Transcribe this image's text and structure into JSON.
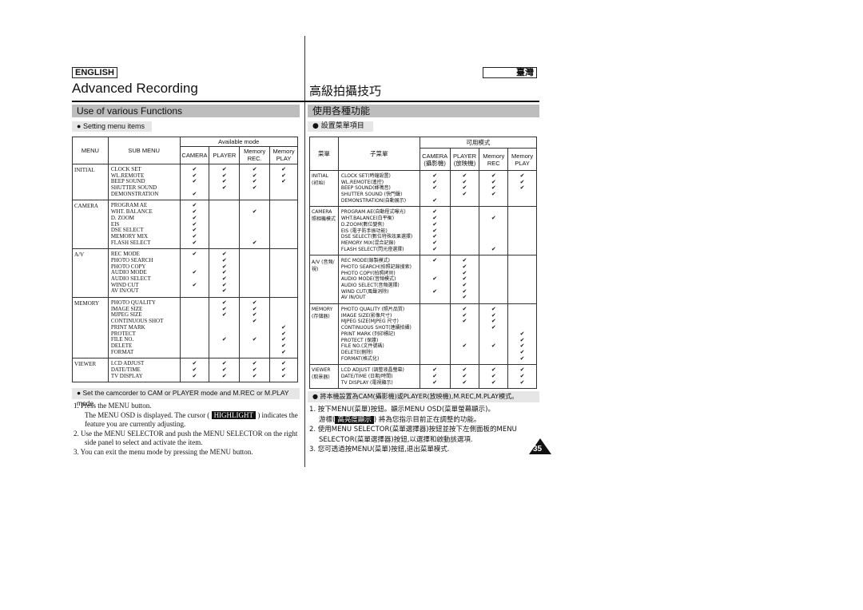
{
  "header": {
    "lang_en": "ENGLISH",
    "lang_zh": "臺灣",
    "title_en": "Advanced Recording",
    "title_zh": "高級拍攝技巧",
    "section_en": "Use of various Functions",
    "section_zh": "使用各種功能",
    "bullet_en": "Setting menu items",
    "bullet_zh": "設置菜單項目"
  },
  "table_en": {
    "menu": "MENU",
    "sub": "SUB MENU",
    "avail": "Available mode",
    "modes": [
      "CAMERA",
      "PLAYER",
      "Memory REC.",
      "Memory PLAY"
    ],
    "groups": [
      {
        "menu": "INITIAL",
        "items": [
          [
            "CLOCK SET",
            [
              1,
              1,
              1,
              1
            ]
          ],
          [
            "WL.REMOTE",
            [
              1,
              1,
              1,
              1
            ]
          ],
          [
            "BEEP SOUND",
            [
              1,
              1,
              1,
              1
            ]
          ],
          [
            "SHUTTER SOUND",
            [
              0,
              1,
              1,
              0
            ]
          ],
          [
            "DEMONSTRATION",
            [
              1,
              0,
              0,
              0
            ]
          ]
        ]
      },
      {
        "menu": "CAMERA",
        "items": [
          [
            "PROGRAM AE",
            [
              1,
              0,
              0,
              0
            ]
          ],
          [
            "WHT. BALANCE",
            [
              1,
              0,
              1,
              0
            ]
          ],
          [
            "D. ZOOM",
            [
              1,
              0,
              0,
              0
            ]
          ],
          [
            "EIS",
            [
              1,
              0,
              0,
              0
            ]
          ],
          [
            "DSE SELECT",
            [
              1,
              0,
              0,
              0
            ]
          ],
          [
            "MEMORY MIX",
            [
              1,
              0,
              0,
              0
            ]
          ],
          [
            "FLASH SELECT",
            [
              1,
              0,
              1,
              0
            ]
          ]
        ]
      },
      {
        "menu": "A/V",
        "items": [
          [
            "REC MODE",
            [
              1,
              1,
              0,
              0
            ]
          ],
          [
            "PHOTO SEARCH",
            [
              0,
              1,
              0,
              0
            ]
          ],
          [
            "PHOTO COPY",
            [
              0,
              1,
              0,
              0
            ]
          ],
          [
            "AUDIO MODE",
            [
              1,
              1,
              0,
              0
            ]
          ],
          [
            "AUDIO SELECT",
            [
              0,
              1,
              0,
              0
            ]
          ],
          [
            "WIND CUT",
            [
              1,
              1,
              0,
              0
            ]
          ],
          [
            "AV IN/OUT",
            [
              0,
              1,
              0,
              0
            ]
          ]
        ]
      },
      {
        "menu": "MEMORY",
        "items": [
          [
            "PHOTO QUALITY",
            [
              0,
              1,
              1,
              0
            ]
          ],
          [
            "IMAGE SIZE",
            [
              0,
              1,
              1,
              0
            ]
          ],
          [
            "MJPEG SIZE",
            [
              0,
              1,
              1,
              0
            ]
          ],
          [
            "CONTINUOUS SHOT",
            [
              0,
              0,
              1,
              0
            ]
          ],
          [
            "PRINT MARK",
            [
              0,
              0,
              0,
              1
            ]
          ],
          [
            "PROTECT",
            [
              0,
              0,
              0,
              1
            ]
          ],
          [
            "FILE NO.",
            [
              0,
              1,
              1,
              1
            ]
          ],
          [
            "DELETE",
            [
              0,
              0,
              0,
              1
            ]
          ],
          [
            "FORMAT",
            [
              0,
              0,
              0,
              1
            ]
          ]
        ]
      },
      {
        "menu": "VIEWER",
        "items": [
          [
            "LCD ADJUST",
            [
              1,
              1,
              1,
              1
            ]
          ],
          [
            "DATE/TIME",
            [
              1,
              1,
              1,
              1
            ]
          ],
          [
            "TV DISPLAY",
            [
              1,
              1,
              1,
              1
            ]
          ]
        ]
      }
    ]
  },
  "table_zh": {
    "menu": "菜單",
    "sub": "子菜單",
    "avail": "可用模式",
    "modes": [
      "CAMERA (攝影機)",
      "PLAYER (放映機)",
      "Memory REC",
      "Memory PLAY"
    ],
    "groups": [
      {
        "menu": "INITIAL (初始)",
        "items": [
          [
            "CLOCK SET(時鐘設置)",
            [
              1,
              1,
              1,
              1
            ]
          ],
          [
            "WL.REMOTE(遙控)",
            [
              1,
              1,
              1,
              1
            ]
          ],
          [
            "BEEP SOUND(蜂鳴音)",
            [
              1,
              1,
              1,
              1
            ]
          ],
          [
            "SHUTTER SOUND (快門聲)",
            [
              0,
              1,
              1,
              0
            ]
          ],
          [
            "DEMONSTRATION(自動展示)",
            [
              1,
              0,
              0,
              0
            ]
          ]
        ]
      },
      {
        "menu": "CAMERA 照相機模式",
        "items": [
          [
            "PROGRAM AE(自動程式曝光)",
            [
              1,
              0,
              0,
              0
            ]
          ],
          [
            "WHT.BALANCE(白平衡)",
            [
              1,
              0,
              1,
              0
            ]
          ],
          [
            "D.ZOOM(數位變焦)",
            [
              1,
              0,
              0,
              0
            ]
          ],
          [
            "EIS (電子防手振功能)",
            [
              1,
              0,
              0,
              0
            ]
          ],
          [
            "DSE SELECT(數位特殊效果選擇)",
            [
              1,
              0,
              0,
              0
            ]
          ],
          [
            "MEMORY MIX(混合記錄)",
            [
              1,
              0,
              0,
              0
            ]
          ],
          [
            "FLASH SELECT(閃光燈選擇)",
            [
              1,
              0,
              1,
              0
            ]
          ]
        ]
      },
      {
        "menu": "A/V (音頻/視)",
        "items": [
          [
            "REC MODE(錄製模式)",
            [
              1,
              1,
              0,
              0
            ]
          ],
          [
            "PHOTO SEARCH(拍照記錄搜索)",
            [
              0,
              1,
              0,
              0
            ]
          ],
          [
            "PHOTO COPY(拍照拷貝)",
            [
              0,
              1,
              0,
              0
            ]
          ],
          [
            "AUDIO MODE(音頻模式)",
            [
              1,
              1,
              0,
              0
            ]
          ],
          [
            "AUDIO SELECT(音頻選擇)",
            [
              0,
              1,
              0,
              0
            ]
          ],
          [
            "WIND CUT(風聲消除)",
            [
              1,
              1,
              0,
              0
            ]
          ],
          [
            "AV IN/OUT",
            [
              0,
              1,
              0,
              0
            ]
          ]
        ]
      },
      {
        "menu": "MEMORY (存儲器)",
        "items": [
          [
            "PHOTO QUALITY (照片品質)",
            [
              0,
              1,
              1,
              0
            ]
          ],
          [
            "IMAGE SIZE(影像尺寸)",
            [
              0,
              1,
              1,
              0
            ]
          ],
          [
            "MJPEG SIZE(MJPEG 尺寸)",
            [
              0,
              1,
              1,
              0
            ]
          ],
          [
            "CONTINUOUS SHOT(連續拍攝)",
            [
              0,
              0,
              1,
              0
            ]
          ],
          [
            "PRINT MARK (列印標記)",
            [
              0,
              0,
              0,
              1
            ]
          ],
          [
            "PROTECT (保護)",
            [
              0,
              0,
              0,
              1
            ]
          ],
          [
            "FILE NO.(文件號碼)",
            [
              0,
              1,
              1,
              1
            ]
          ],
          [
            "DELETE(刪除)",
            [
              0,
              0,
              0,
              1
            ]
          ],
          [
            "FORMAT(格式化)",
            [
              0,
              0,
              0,
              1
            ]
          ]
        ]
      },
      {
        "menu": "VIEWER (取景器)",
        "items": [
          [
            "LCD ADJUST (調整液晶螢幕)",
            [
              1,
              1,
              1,
              1
            ]
          ],
          [
            "DATE/TIME (日期/時間)",
            [
              1,
              1,
              1,
              1
            ]
          ],
          [
            "TV DISPLAY (電視顯示)",
            [
              1,
              1,
              1,
              1
            ]
          ]
        ]
      }
    ]
  },
  "notes_en": {
    "bullet": "Set the camcorder to CAM or PLAYER mode and M.REC or M.PLAY mode",
    "s1": "1.  Press the MENU button.",
    "s1b": "The MENU OSD is displayed. The cursor (",
    "hl": "HIGHLIGHT",
    "s1c": ") indicates the",
    "s1d": "feature you are currently adjusting.",
    "s2": "2.  Use the MENU SELECTOR and push the MENU SELECTOR on the right",
    "s2b": "side panel to select and activate the item.",
    "s3": "3.  You can exit the menu mode by pressing the MENU button."
  },
  "notes_zh": {
    "bullet": "將本機設置為CAM(攝影機)或PLAYER(放映機),M.REC,M.PLAY模式。",
    "s1": "1.  按下MENU(菜單)按鈕。顯示MENU OSD(菜單螢幕顯示)。",
    "s1b": "游標(",
    "hl": "高亮度顯示",
    "s1c": ") 將為您指示目前正在調整的功能。",
    "s2": "2.  使用MENU SELECTOR(菜單選擇器)按鈕並按下左側面板的MENU",
    "s2b": "SELECTOR(菜單選擇器)按鈕,以選擇和啟動該選項.",
    "s3": "3.  您可透過按MENU(菜單)按鈕,退出菜單模式."
  },
  "page_number": "35",
  "check_glyph": "✔"
}
